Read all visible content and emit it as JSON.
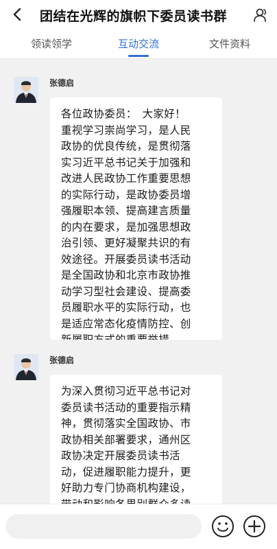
{
  "header": {
    "title": "团结在光辉的旗帜下委员读书群",
    "back_icon": "chevron-left-icon",
    "members_icon": "person-icon"
  },
  "tabs": [
    {
      "label": "领读领学",
      "active": false
    },
    {
      "label": "互动交流",
      "active": true
    },
    {
      "label": "文件资料",
      "active": false
    }
  ],
  "colors": {
    "accent": "#2f6fd6",
    "background": "#f1f1f1"
  },
  "messages": [
    {
      "sender": "张德启",
      "lines": [
        "各位政协委员：　大家好！",
        "重视学习崇尚学习，是人民",
        "政协的优良传统，是贯彻落",
        "实习近平总书记关于加强和",
        "改进人民政协工作重要思想",
        "的实际行动，是政协委员增",
        "强履职本领、提高建言质量",
        "的内在要求，是加强思想政",
        "治引领、更好凝聚共识的有",
        "效途径。开展委员读书活动",
        "是全国政协和北京市政协推",
        "动学习型社会建设、提高委",
        "员履职水平的实际行动，也",
        "是适应常态化疫情防控、创",
        "新履职方式的重要举措。"
      ]
    },
    {
      "sender": "张德启",
      "lines": [
        "为深入贯彻习近平总书记对",
        "委员读书活动的重要指示精",
        "神，贯彻落实全国政协、市",
        "政协相关部署要求，通州区",
        "政协决定开展委员读书活",
        "动，促进履职能力提升，更",
        "好助力专门协商机构建设，",
        "带动和影响各界别群众多读"
      ]
    }
  ],
  "bottom_bar": {
    "input_placeholder": "",
    "emoji_icon": "smiley-icon",
    "add_icon": "plus-circle-icon"
  }
}
